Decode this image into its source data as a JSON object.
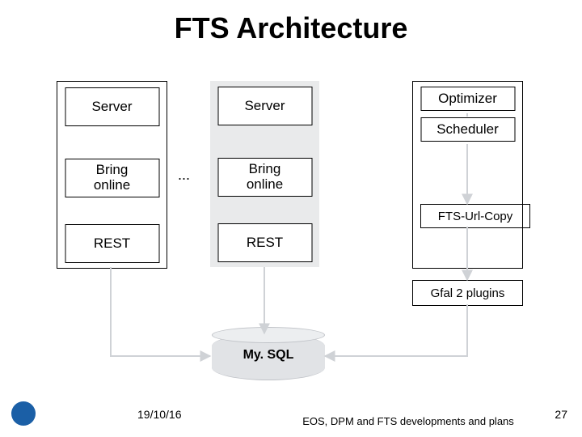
{
  "title": "FTS Architecture",
  "col_a": {
    "server": "Server",
    "bring_online": "Bring\nonline",
    "rest": "REST"
  },
  "dots": "...",
  "col_b": {
    "server": "Server",
    "bring_online": "Bring\nonline",
    "rest": "REST"
  },
  "col_c": {
    "optimizer": "Optimizer",
    "scheduler": "Scheduler"
  },
  "url_copy": "FTS-Url-Copy",
  "gfal_plugins": "Gfal 2 plugins",
  "db_label": "My. SQL",
  "footer": {
    "date": "19/10/16",
    "caption": "EOS, DPM and FTS developments and plans",
    "page": "27"
  }
}
